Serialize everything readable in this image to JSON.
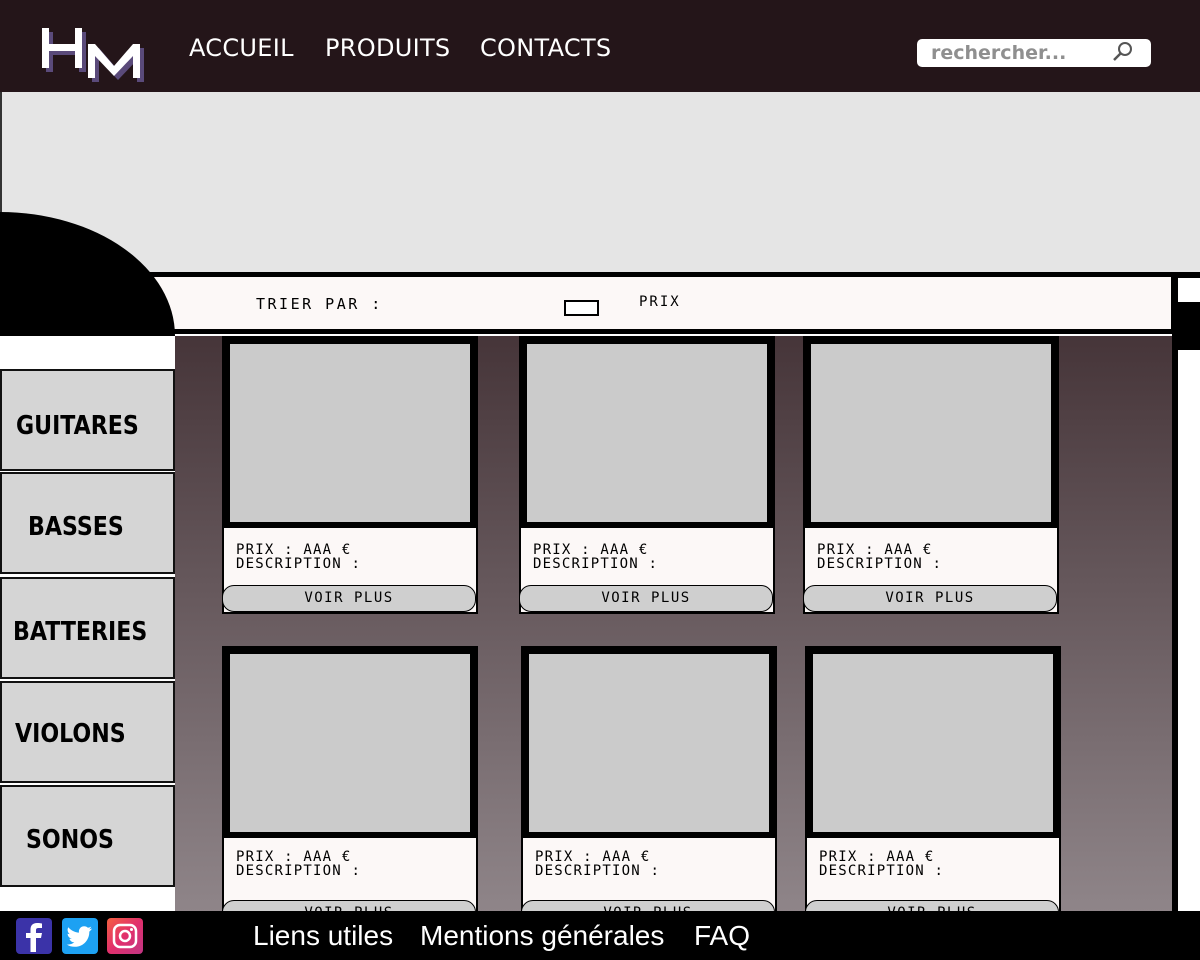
{
  "header": {
    "logo_text": "HM",
    "nav": [
      "ACCUEIL",
      "PRODUITS",
      "CONTACTS"
    ],
    "search_placeholder": "rechercher..."
  },
  "sort": {
    "label": "TRIER PAR :",
    "option": "PRIX"
  },
  "sidebar": {
    "items": [
      "GUITARES",
      "BASSES",
      "BATTERIES",
      "VIOLONS",
      "SONOS"
    ]
  },
  "products": [
    {
      "price": "PRIX : AAA €",
      "description": "DESCRIPTION :",
      "button": "VOIR PLUS"
    },
    {
      "price": "PRIX : AAA €",
      "description": "DESCRIPTION :",
      "button": "VOIR PLUS"
    },
    {
      "price": "PRIX : AAA €",
      "description": "DESCRIPTION :",
      "button": "VOIR PLUS"
    },
    {
      "price": "PRIX : AAA €",
      "description": "DESCRIPTION :",
      "button": "VOIR PLUS"
    },
    {
      "price": "PRIX : AAA €",
      "description": "DESCRIPTION :",
      "button": "VOIR PLUS"
    },
    {
      "price": "PRIX : AAA €",
      "description": "DESCRIPTION :",
      "button": "VOIR PLUS"
    }
  ],
  "footer": {
    "social_icons": [
      "facebook-icon",
      "twitter-icon",
      "instagram-icon"
    ],
    "links": [
      "Liens utiles",
      "Mentions générales",
      "FAQ"
    ]
  },
  "colors": {
    "header_bg": "#241519",
    "footer_bg": "#000000",
    "banner_bg": "#e5e5e5",
    "facebook": "#3b33a8",
    "twitter": "#1da1f2",
    "instagram": "#e83e7e"
  }
}
